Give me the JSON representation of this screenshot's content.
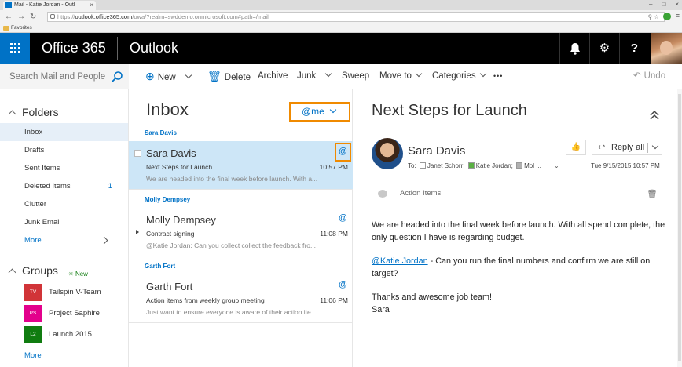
{
  "browser": {
    "tab_title": "Mail - Katie Jordan - Outl",
    "url_host": "outlook.office365.com",
    "url_rest": "/owa/?realm=swddemo.onmicrosoft.com#path=/mail",
    "url_scheme": "https://",
    "bookmark_folder": "Favorites"
  },
  "header": {
    "brand": "Office 365",
    "app": "Outlook",
    "brand_color": "#0072c6"
  },
  "commands": {
    "search_placeholder": "Search Mail and People",
    "new_label": "New",
    "delete_label": "Delete",
    "archive_label": "Archive",
    "junk_label": "Junk",
    "sweep_label": "Sweep",
    "move_to_label": "Move to",
    "categories_label": "Categories",
    "more_label": "•••",
    "undo_label": "Undo"
  },
  "folders": {
    "section_title": "Folders",
    "items": [
      {
        "label": "Inbox",
        "count": ""
      },
      {
        "label": "Drafts",
        "count": ""
      },
      {
        "label": "Sent Items",
        "count": ""
      },
      {
        "label": "Deleted Items",
        "count": "1"
      },
      {
        "label": "Clutter",
        "count": ""
      },
      {
        "label": "Junk Email",
        "count": ""
      }
    ],
    "more_label": "More"
  },
  "groups": {
    "section_title": "Groups",
    "new_label": "New",
    "items": [
      {
        "initials": "TV",
        "label": "Tailspin V-Team",
        "color": "#d13438"
      },
      {
        "initials": "PS",
        "label": "Project Saphire",
        "color": "#e3008c"
      },
      {
        "initials": "L2",
        "label": "Launch 2015",
        "color": "#107c10"
      }
    ],
    "more_label": "More"
  },
  "message_list": {
    "title": "Inbox",
    "filter_label": "@me",
    "groups": [
      {
        "header": "Sara Davis",
        "sender": "Sara Davis",
        "subject": "Next Steps for Launch",
        "time": "10:57 PM",
        "preview": "We are headed into the final week before launch. With a..."
      },
      {
        "header": "Molly Dempsey",
        "sender": "Molly Dempsey",
        "subject": "Contract signing",
        "time": "11:08 PM",
        "preview": "@Katie Jordan: Can you collect collect the feedback fro..."
      },
      {
        "header": "Garth Fort",
        "sender": "Garth Fort",
        "subject": "Action items from weekly group meeting",
        "time": "11:06 PM",
        "preview": "Just want to ensure everyone is aware of their action ite..."
      }
    ],
    "mention_symbol": "@"
  },
  "reading": {
    "subject": "Next Steps for Launch",
    "sender": "Sara Davis",
    "to_label": "To:",
    "recipients": [
      {
        "name": "Janet Schorr;",
        "color": "#ffffff"
      },
      {
        "name": "Katie Jordan;",
        "color": "#5ab043"
      },
      {
        "name": "Mol ...",
        "color": "#b0b0b0"
      }
    ],
    "date": "Tue 9/15/2015 10:57 PM",
    "reply_all_label": "Reply all",
    "action_items_label": "Action Items",
    "body_p1": "We are headed into the final week before launch.  With all spend complete, the only question I have is regarding budget.",
    "mention": "@Katie Jordan",
    "body_p2": " - Can you run the final numbers and confirm we are still on target?",
    "body_p3a": "Thanks and awesome job team!!",
    "body_p3b": "Sara"
  }
}
